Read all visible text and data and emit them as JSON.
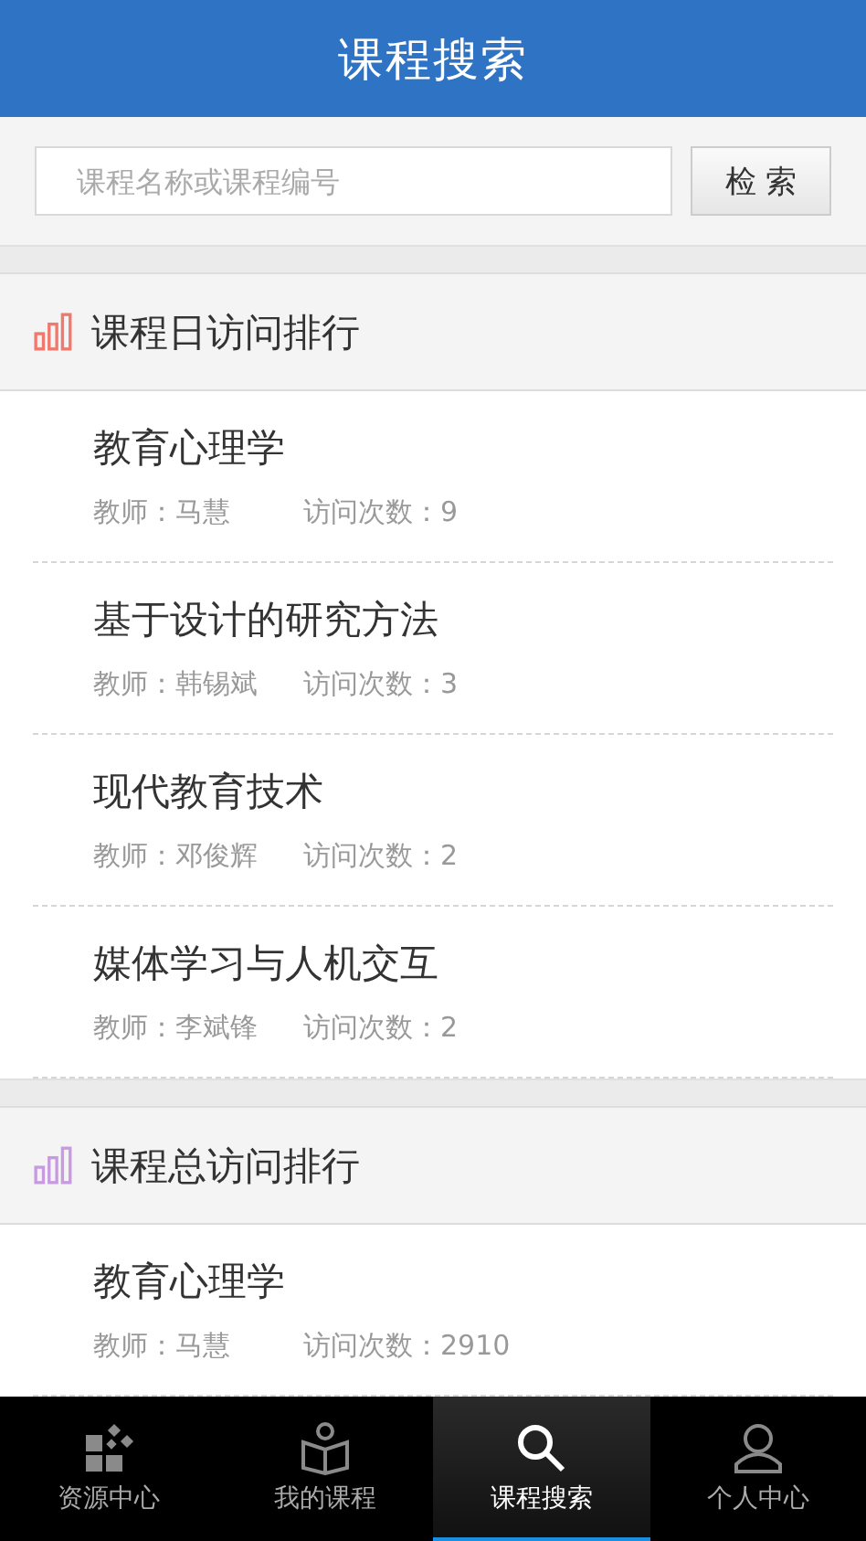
{
  "header": {
    "title": "课程搜索"
  },
  "search": {
    "placeholder": "课程名称或课程编号",
    "button": "检 索"
  },
  "sections": [
    {
      "title": "课程日访问排行",
      "color": "#f0786c",
      "items": [
        {
          "name": "教育心理学",
          "teacher": "教师：马慧",
          "visits": "访问次数：9"
        },
        {
          "name": "基于设计的研究方法",
          "teacher": "教师：韩锡斌",
          "visits": "访问次数：3"
        },
        {
          "name": "现代教育技术",
          "teacher": "教师：邓俊辉",
          "visits": "访问次数：2"
        },
        {
          "name": "媒体学习与人机交互",
          "teacher": "教师：李斌锋",
          "visits": "访问次数：2"
        }
      ]
    },
    {
      "title": "课程总访问排行",
      "color": "#c89ae0",
      "items": [
        {
          "name": "教育心理学",
          "teacher": "教师：马慧",
          "visits": "访问次数：2910"
        }
      ]
    }
  ],
  "tabs": [
    {
      "label": "资源中心",
      "kind": "resources",
      "selected": false
    },
    {
      "label": "我的课程",
      "kind": "courses",
      "selected": false
    },
    {
      "label": "课程搜索",
      "kind": "search",
      "selected": true
    },
    {
      "label": "个人中心",
      "kind": "profile",
      "selected": false
    }
  ]
}
